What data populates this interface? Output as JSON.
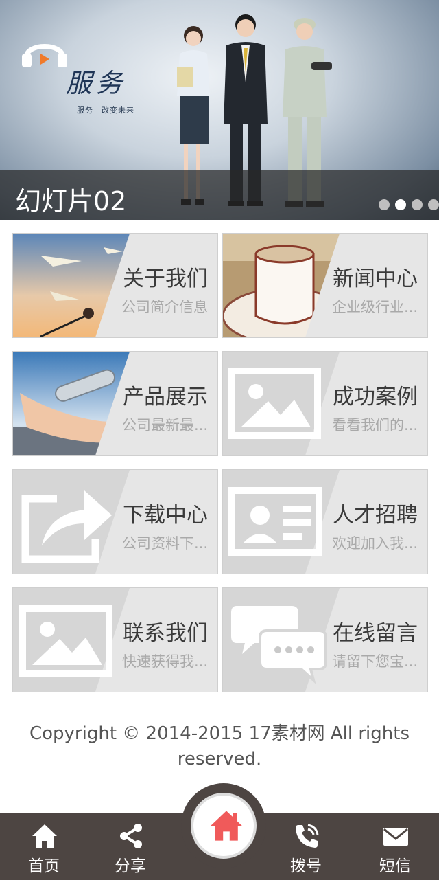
{
  "banner": {
    "brand_script": "服务",
    "brand_tagline": "服务　改变未来",
    "caption": "幻灯片02",
    "dots": 4,
    "active_dot": 1
  },
  "tiles": [
    {
      "title": "关于我们",
      "desc": "公司简介信息",
      "icon": "paper-plane-photo"
    },
    {
      "title": "新闻中心",
      "desc": "企业级行业...",
      "icon": "coffee-cup-photo"
    },
    {
      "title": "产品展示",
      "desc": "公司最新最...",
      "icon": "hand-tube-photo"
    },
    {
      "title": "成功案例",
      "desc": "看看我们的...",
      "icon": "image-placeholder-icon"
    },
    {
      "title": "下载中心",
      "desc": "公司资料下...",
      "icon": "share-arrow-icon"
    },
    {
      "title": "人才招聘",
      "desc": "欢迎加入我...",
      "icon": "id-card-icon"
    },
    {
      "title": "联系我们",
      "desc": "快速获得我...",
      "icon": "image-placeholder-icon"
    },
    {
      "title": "在线留言",
      "desc": "请留下您宝...",
      "icon": "chat-bubbles-icon"
    }
  ],
  "copyright": "Copyright © 2014-2015 17素材网 All rights reserved.",
  "footer": {
    "items": [
      {
        "label": "首页",
        "icon": "home-icon"
      },
      {
        "label": "分享",
        "icon": "share-icon"
      },
      {
        "label": "拨号",
        "icon": "phone-icon"
      },
      {
        "label": "短信",
        "icon": "mail-icon"
      }
    ],
    "center_icon": "home-icon",
    "accent": "#f05a5a"
  }
}
